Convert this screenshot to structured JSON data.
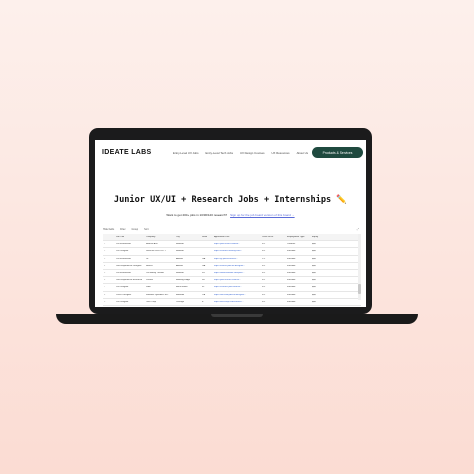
{
  "nav": {
    "logo": "IDEATE LABS",
    "links": [
      "Entry-Level UX Jobs",
      "Entry-Level Tech Jobs",
      "UX Design Courses",
      "UX Resources",
      "About Us"
    ],
    "cta": "Products & Services"
  },
  "headline": "Junior UX/UI + Research Jobs + Internships ✏️",
  "subline": {
    "text": "Want to get 200+ jobs in 10/30/120 research?",
    "link": "Sign up for the job board version of this board →"
  },
  "toolbar": {
    "items": [
      "Hide fields",
      "Filter",
      "Group",
      "Sort"
    ],
    "right": "⤢"
  },
  "table": {
    "columns": [
      "",
      "Job Title",
      "Company",
      "City",
      "State",
      "Application Link",
      "Years of Ex.",
      "Employment Type",
      "Equity"
    ],
    "rows": [
      {
        "n": "1",
        "title": "UX Researcher",
        "company": "BREWLANT",
        "city": "Remote",
        "state": "",
        "link": "https://jobs.lever.co/brew...",
        "year": "0-1",
        "type": "Contract",
        "equity": "$$$"
      },
      {
        "n": "2",
        "title": "UX Designer",
        "company": "DESIGN VELOCITY",
        "city": "Remote",
        "state": "",
        "link": "https://careers.velocity.com...",
        "year": "0-2",
        "type": "Full-time",
        "equity": "$$$"
      },
      {
        "n": "3",
        "title": "UX Researcher",
        "company": "Gl",
        "city": "Atlanta",
        "state": "GA",
        "link": "https://gl.jobs/research...",
        "year": "1-2",
        "type": "Full-time",
        "equity": "$$$"
      },
      {
        "n": "4",
        "title": "User Experience Designer",
        "company": "Hearst",
        "city": "Atlanta",
        "state": "GA",
        "link": "https://hearst.jobs/ux-designer...",
        "year": "0-2",
        "type": "Full-time",
        "equity": "$$$"
      },
      {
        "n": "5",
        "title": "UX Researcher",
        "company": "On Money Tracker",
        "city": "Remote",
        "state": "NY",
        "link": "https://www.linkedin.com/jobs...",
        "year": "0-2",
        "type": "Full-time",
        "equity": "$$$"
      },
      {
        "n": "6",
        "title": "User Experience Research",
        "company": "Lincoln",
        "city": "Bowling Ridge",
        "state": "NJ",
        "link": "https://jobs.lincoln.com/ux...",
        "year": "0-1",
        "type": "Full-time",
        "equity": "$$$"
      },
      {
        "n": "7",
        "title": "UX Designer",
        "company": "Jabil",
        "city": "Boca Raton",
        "state": "FL",
        "link": "https://careers.jabil.com/ux...",
        "year": "0-2",
        "type": "Full-time",
        "equity": "$$$"
      },
      {
        "n": "8",
        "title": "UX/UI Designer",
        "company": "Webster Dynamics Inc.",
        "city": "Burbank",
        "state": "CA",
        "link": "https://wd.com/jobs/ui-designer...",
        "year": "0-2",
        "type": "Full-time",
        "equity": "$$$"
      },
      {
        "n": "9",
        "title": "UX Designer",
        "company": "Tech Corp",
        "city": "Chicago",
        "state": "IL",
        "link": "https://techcorp.com/careers...",
        "year": "0-2",
        "type": "Full-time",
        "equity": "$$$"
      },
      {
        "n": "10",
        "title": "Product Designer",
        "company": "Gravitas",
        "city": "Remote",
        "state": "",
        "link": "https://gravitas.com/jobs...",
        "year": "0-2",
        "type": "Full-time",
        "equity": "$$$"
      }
    ]
  }
}
